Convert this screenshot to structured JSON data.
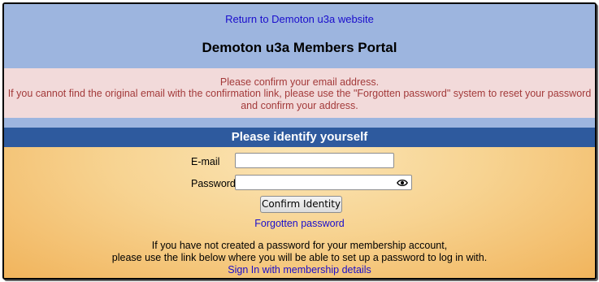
{
  "header": {
    "back_link": "Return to Demoton u3a website",
    "title": "Demoton u3a Members Portal"
  },
  "alert": {
    "line1": "Please confirm your email address.",
    "line2": "If you cannot find the original email with the confirmation link, please use the \"Forgotten password\" system to reset your password and confirm your address."
  },
  "login": {
    "heading": "Please identify yourself",
    "email_label": "E-mail",
    "email_value": "",
    "password_label": "Password",
    "password_value": "",
    "confirm_button": "Confirm Identity",
    "forgot_link": "Forgotten password",
    "eye_icon": "eye-icon"
  },
  "footer": {
    "line1": "If you have not created a password for your membership account,",
    "line2": "please use the link below where you will be able to set up a password to log in with.",
    "signin_link": "Sign In with membership details"
  },
  "colors": {
    "header_bg": "#9db5df",
    "alert_bg": "#f2dada",
    "alert_text": "#a33a3a",
    "bar_bg": "#2e5a9e",
    "link": "#1a0dcc",
    "section_bg": "#f5c06a"
  }
}
